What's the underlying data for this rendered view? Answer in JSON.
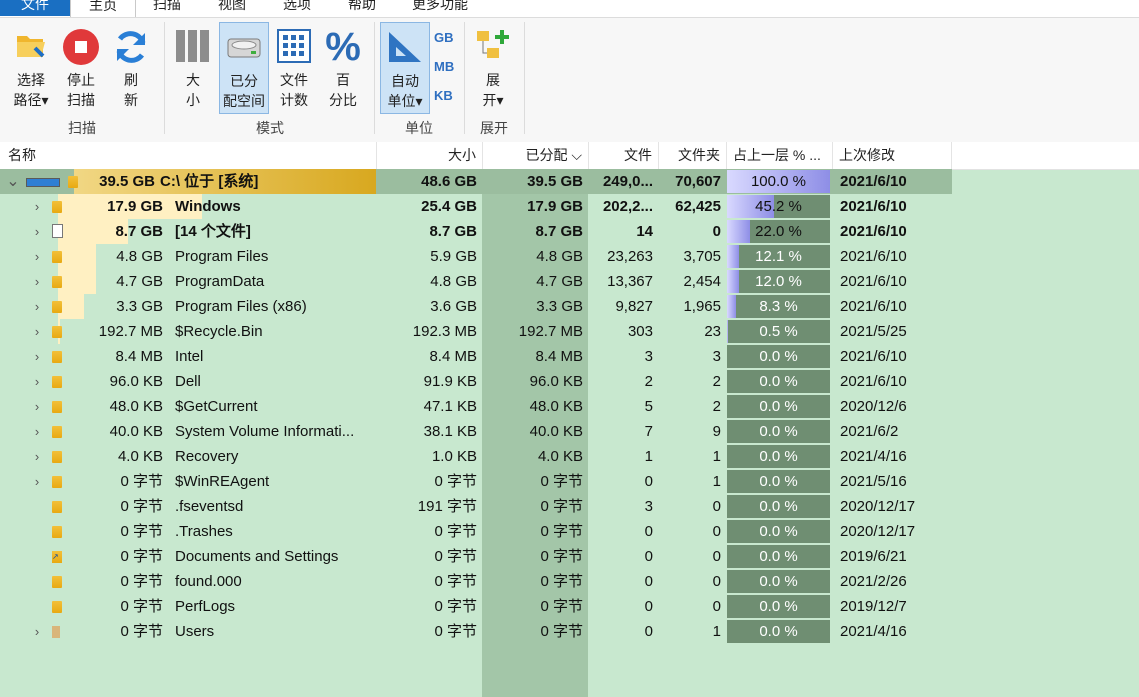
{
  "ribbon_tabs": [
    "文件",
    "主页",
    "扫描",
    "视图",
    "选项",
    "帮助",
    "更多功能"
  ],
  "ribbon": {
    "buttons": [
      {
        "label": "选择\n路径▾",
        "icon": "folder-open-icon"
      },
      {
        "label": "停止\n扫描",
        "icon": "stop-icon"
      },
      {
        "label": "刷\n新",
        "icon": "refresh-icon"
      },
      {
        "label": "大\n小",
        "icon": "size-bars-icon"
      },
      {
        "label": "已分\n配空间",
        "icon": "disk-icon"
      },
      {
        "label": "文件\n计数",
        "icon": "file-grid-icon"
      },
      {
        "label": "百\n分比",
        "icon": "percent-icon"
      },
      {
        "label": "自动\n单位▾",
        "icon": "triangle-ruler-icon"
      },
      {
        "label": "展\n开▾",
        "icon": "expand-icon"
      }
    ],
    "units": [
      "GB",
      "MB",
      "KB"
    ],
    "groups": [
      "扫描",
      "模式",
      "单位",
      "展开"
    ]
  },
  "columns": [
    "名称",
    "大小",
    "已分配 ⌵",
    "文件",
    "文件夹",
    "占上一层 % ...",
    "上次修改"
  ],
  "rows": [
    {
      "level": 0,
      "expand": "v",
      "icon": "folder",
      "bar": 1.0,
      "size": "39.5 GB",
      "name": "C:\\  位于  [系统]",
      "disk": "48.6 GB",
      "alloc": "39.5 GB",
      "files": "249,0...",
      "folders": "70,607",
      "pct": "100.0 %",
      "pctv": 1.0,
      "date": "2021/6/10",
      "bold": true,
      "root": true
    },
    {
      "level": 1,
      "expand": ">",
      "icon": "folder",
      "bar": 0.453,
      "size": "17.9 GB",
      "name": "Windows",
      "disk": "25.4 GB",
      "alloc": "17.9 GB",
      "files": "202,2...",
      "folders": "62,425",
      "pct": "45.2 %",
      "pctv": 0.452,
      "date": "2021/6/10",
      "bold": true
    },
    {
      "level": 1,
      "expand": ">",
      "icon": "file",
      "bar": 0.22,
      "size": "8.7 GB",
      "name": "[14 个文件]",
      "disk": "8.7 GB",
      "alloc": "8.7 GB",
      "files": "14",
      "folders": "0",
      "pct": "22.0 %",
      "pctv": 0.22,
      "date": "2021/6/10",
      "bold": true
    },
    {
      "level": 1,
      "expand": ">",
      "icon": "folder",
      "bar": 0.121,
      "size": "4.8 GB",
      "name": "Program Files",
      "disk": "5.9 GB",
      "alloc": "4.8 GB",
      "files": "23,263",
      "folders": "3,705",
      "pct": "12.1 %",
      "pctv": 0.121,
      "date": "2021/6/10"
    },
    {
      "level": 1,
      "expand": ">",
      "icon": "folder",
      "bar": 0.12,
      "size": "4.7 GB",
      "name": "ProgramData",
      "disk": "4.8 GB",
      "alloc": "4.7 GB",
      "files": "13,367",
      "folders": "2,454",
      "pct": "12.0 %",
      "pctv": 0.12,
      "date": "2021/6/10"
    },
    {
      "level": 1,
      "expand": ">",
      "icon": "folder",
      "bar": 0.083,
      "size": "3.3 GB",
      "name": "Program Files (x86)",
      "disk": "3.6 GB",
      "alloc": "3.3 GB",
      "files": "9,827",
      "folders": "1,965",
      "pct": "8.3 %",
      "pctv": 0.083,
      "date": "2021/6/10"
    },
    {
      "level": 1,
      "expand": ">",
      "icon": "folder",
      "bar": 0.005,
      "size": "192.7 MB",
      "name": "$Recycle.Bin",
      "disk": "192.3 MB",
      "alloc": "192.7 MB",
      "files": "303",
      "folders": "23",
      "pct": "0.5 %",
      "pctv": 0.005,
      "date": "2021/5/25"
    },
    {
      "level": 1,
      "expand": ">",
      "icon": "folder",
      "bar": 0,
      "size": "8.4 MB",
      "name": "Intel",
      "disk": "8.4 MB",
      "alloc": "8.4 MB",
      "files": "3",
      "folders": "3",
      "pct": "0.0 %",
      "pctv": 0,
      "date": "2021/6/10"
    },
    {
      "level": 1,
      "expand": ">",
      "icon": "folder",
      "bar": 0,
      "size": "96.0 KB",
      "name": "Dell",
      "disk": "91.9 KB",
      "alloc": "96.0 KB",
      "files": "2",
      "folders": "2",
      "pct": "0.0 %",
      "pctv": 0,
      "date": "2021/6/10"
    },
    {
      "level": 1,
      "expand": ">",
      "icon": "folder",
      "bar": 0,
      "size": "48.0 KB",
      "name": "$GetCurrent",
      "disk": "47.1 KB",
      "alloc": "48.0 KB",
      "files": "5",
      "folders": "2",
      "pct": "0.0 %",
      "pctv": 0,
      "date": "2020/12/6"
    },
    {
      "level": 1,
      "expand": ">",
      "icon": "folder",
      "bar": 0,
      "size": "40.0 KB",
      "name": "System Volume Informati...",
      "disk": "38.1 KB",
      "alloc": "40.0 KB",
      "files": "7",
      "folders": "9",
      "pct": "0.0 %",
      "pctv": 0,
      "date": "2021/6/2"
    },
    {
      "level": 1,
      "expand": ">",
      "icon": "folder",
      "bar": 0,
      "size": "4.0 KB",
      "name": "Recovery",
      "disk": "1.0 KB",
      "alloc": "4.0 KB",
      "files": "1",
      "folders": "1",
      "pct": "0.0 %",
      "pctv": 0,
      "date": "2021/4/16"
    },
    {
      "level": 1,
      "expand": ">",
      "icon": "folder",
      "bar": 0,
      "size": "0 字节",
      "name": "$WinREAgent",
      "disk": "0 字节",
      "alloc": "0 字节",
      "files": "0",
      "folders": "1",
      "pct": "0.0 %",
      "pctv": 0,
      "date": "2021/5/16"
    },
    {
      "level": 1,
      "expand": "",
      "icon": "folder",
      "bar": 0,
      "size": "0 字节",
      "name": ".fseventsd",
      "disk": "191 字节",
      "alloc": "0 字节",
      "files": "3",
      "folders": "0",
      "pct": "0.0 %",
      "pctv": 0,
      "date": "2020/12/17"
    },
    {
      "level": 1,
      "expand": "",
      "icon": "folder",
      "bar": 0,
      "size": "0 字节",
      "name": ".Trashes",
      "disk": "0 字节",
      "alloc": "0 字节",
      "files": "0",
      "folders": "0",
      "pct": "0.0 %",
      "pctv": 0,
      "date": "2020/12/17"
    },
    {
      "level": 1,
      "expand": "",
      "icon": "link",
      "bar": 0,
      "size": "0 字节",
      "name": "Documents and Settings",
      "disk": "0 字节",
      "alloc": "0 字节",
      "files": "0",
      "folders": "0",
      "pct": "0.0 %",
      "pctv": 0,
      "date": "2019/6/21"
    },
    {
      "level": 1,
      "expand": "",
      "icon": "folder",
      "bar": 0,
      "size": "0 字节",
      "name": "found.000",
      "disk": "0 字节",
      "alloc": "0 字节",
      "files": "0",
      "folders": "0",
      "pct": "0.0 %",
      "pctv": 0,
      "date": "2021/2/26"
    },
    {
      "level": 1,
      "expand": "",
      "icon": "folder",
      "bar": 0,
      "size": "0 字节",
      "name": "PerfLogs",
      "disk": "0 字节",
      "alloc": "0 字节",
      "files": "0",
      "folders": "0",
      "pct": "0.0 %",
      "pctv": 0,
      "date": "2019/12/7"
    },
    {
      "level": 1,
      "expand": ">",
      "icon": "hourglass",
      "bar": 0,
      "size": "0 字节",
      "name": "Users",
      "disk": "0 字节",
      "alloc": "0 字节",
      "files": "0",
      "folders": "1",
      "pct": "0.0 %",
      "pctv": 0,
      "date": "2021/4/16"
    }
  ]
}
